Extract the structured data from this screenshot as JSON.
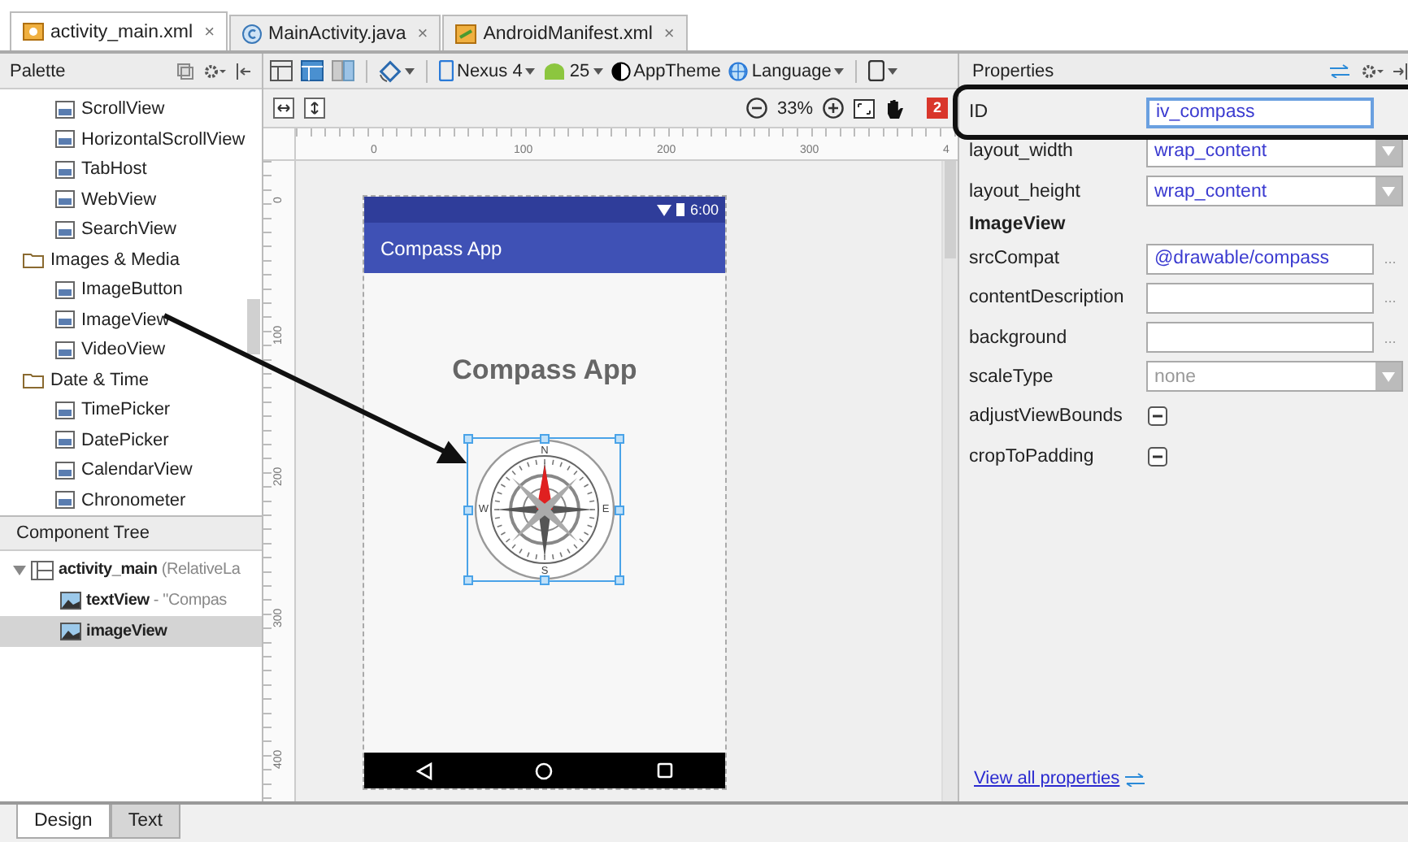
{
  "file_tabs": [
    {
      "label": "activity_main.xml",
      "close": "×",
      "selected": true,
      "kind": "xml"
    },
    {
      "label": "MainActivity.java",
      "close": "×",
      "selected": false,
      "kind": "class"
    },
    {
      "label": "AndroidManifest.xml",
      "close": "×",
      "selected": false,
      "kind": "manifest"
    }
  ],
  "palette": {
    "title": "Palette",
    "items": [
      {
        "kind": "widget",
        "label": "ScrollView"
      },
      {
        "kind": "widget",
        "label": "HorizontalScrollView"
      },
      {
        "kind": "widget",
        "label": "TabHost"
      },
      {
        "kind": "widget",
        "label": "WebView"
      },
      {
        "kind": "widget",
        "label": "SearchView"
      },
      {
        "kind": "category",
        "label": "Images & Media"
      },
      {
        "kind": "widget",
        "label": "ImageButton"
      },
      {
        "kind": "widget",
        "label": "ImageView"
      },
      {
        "kind": "widget",
        "label": "VideoView"
      },
      {
        "kind": "category",
        "label": "Date & Time"
      },
      {
        "kind": "widget",
        "label": "TimePicker"
      },
      {
        "kind": "widget",
        "label": "DatePicker"
      },
      {
        "kind": "widget",
        "label": "CalendarView"
      },
      {
        "kind": "widget",
        "label": "Chronometer"
      }
    ]
  },
  "component_tree": {
    "title": "Component Tree",
    "nodes": [
      {
        "name": "activity_main",
        "detail": "(RelativeLa",
        "expanded": true,
        "selected": false,
        "children": [
          {
            "name": "textView",
            "detail": "- \"Compas",
            "selected": false
          },
          {
            "name": "imageView",
            "selected": true
          }
        ]
      }
    ]
  },
  "canvas_toolbar": {
    "device": "Nexus 4",
    "api": "25",
    "theme": "AppTheme",
    "language": "Language",
    "zoom": "33%",
    "error_count": "2"
  },
  "ruler": {
    "x_ticks": [
      "0",
      "100",
      "200",
      "300",
      "4"
    ],
    "y_ticks": [
      "0",
      "100",
      "200",
      "300",
      "400"
    ]
  },
  "phone": {
    "time": "6:00",
    "app_bar_title": "Compass App",
    "heading": "Compass App",
    "compass_letters": [
      "N",
      "E",
      "S",
      "W"
    ]
  },
  "properties": {
    "title": "Properties",
    "rows": [
      {
        "kind": "text",
        "label": "ID",
        "value": "iv_compass",
        "focused": true
      },
      {
        "kind": "select",
        "label": "layout_width",
        "value": "wrap_content"
      },
      {
        "kind": "select",
        "label": "layout_height",
        "value": "wrap_content"
      },
      {
        "kind": "section",
        "label": "ImageView"
      },
      {
        "kind": "text",
        "label": "srcCompat",
        "value": "@drawable/compass",
        "focused": false,
        "more": "..."
      },
      {
        "kind": "text",
        "label": "contentDescription",
        "focused": false,
        "more": "..."
      },
      {
        "kind": "text",
        "label": "background",
        "focused": false,
        "more": "..."
      },
      {
        "kind": "select",
        "label": "scaleType",
        "placeholder": "none"
      },
      {
        "kind": "check",
        "label": "adjustViewBounds",
        "indeterminate": true
      },
      {
        "kind": "check",
        "label": "cropToPadding",
        "indeterminate": true
      }
    ],
    "link": "View all properties"
  },
  "bottom_tabs": [
    {
      "label": "Design",
      "selected": true
    },
    {
      "label": "Text",
      "selected": false
    }
  ]
}
